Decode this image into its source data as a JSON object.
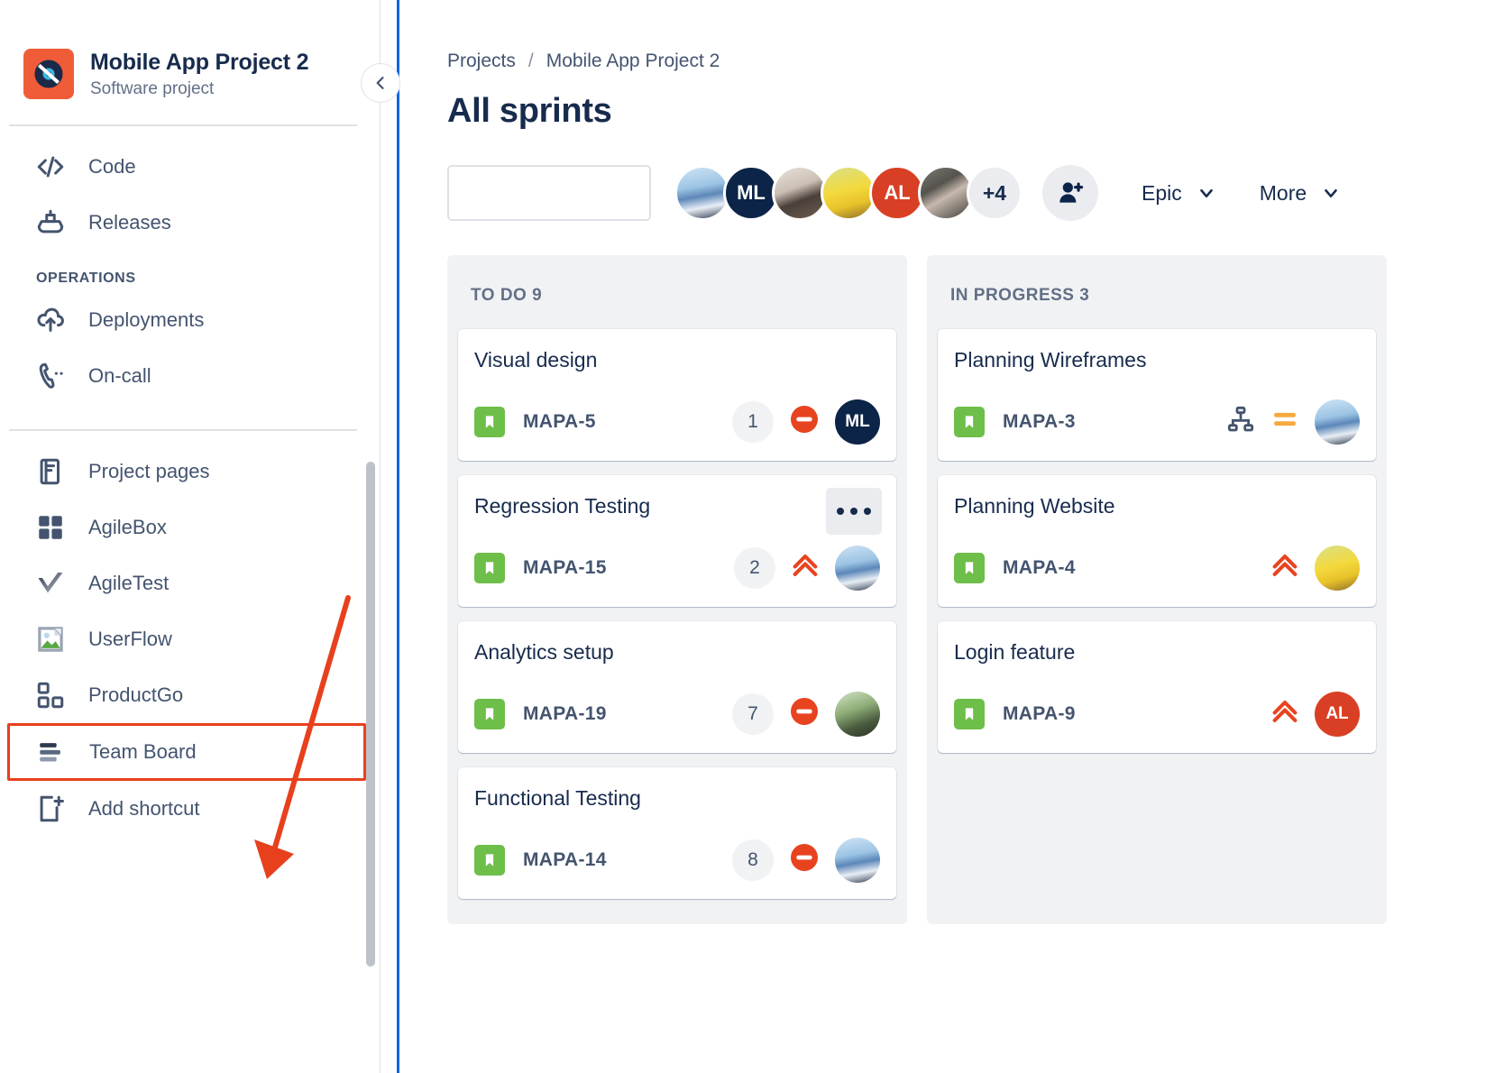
{
  "sidebar": {
    "project": {
      "name": "Mobile App Project 2",
      "type": "Software project",
      "avatar_icon": "vinyl-record-icon"
    },
    "items_top": [
      {
        "label": "Code",
        "icon": "code-icon"
      },
      {
        "label": "Releases",
        "icon": "ship-icon"
      }
    ],
    "section_operations": "OPERATIONS",
    "items_operations": [
      {
        "label": "Deployments",
        "icon": "cloud-upload-icon"
      },
      {
        "label": "On-call",
        "icon": "phone-icon"
      }
    ],
    "items_apps": [
      {
        "label": "Project pages",
        "icon": "page-icon"
      },
      {
        "label": "AgileBox",
        "icon": "grid-icon"
      },
      {
        "label": "AgileTest",
        "icon": "checkmark-icon"
      },
      {
        "label": "UserFlow",
        "icon": "image-icon"
      },
      {
        "label": "ProductGo",
        "icon": "squares-icon"
      },
      {
        "label": "Team Board",
        "icon": "bars-icon",
        "highlighted": true
      },
      {
        "label": "Add shortcut",
        "icon": "add-shortcut-icon"
      }
    ]
  },
  "header": {
    "breadcrumb": {
      "root": "Projects",
      "separator": "/",
      "current": "Mobile App Project 2"
    },
    "title": "All sprints"
  },
  "toolbar": {
    "search": {
      "value": "",
      "placeholder": ""
    },
    "avatars": [
      {
        "name": "member-1",
        "initials": "",
        "style": "ph-snow"
      },
      {
        "name": "member-2",
        "initials": "ML",
        "style": "ph-dark"
      },
      {
        "name": "member-3",
        "initials": "",
        "style": "ph-glass"
      },
      {
        "name": "member-4",
        "initials": "",
        "style": "ph-yellow"
      },
      {
        "name": "member-5",
        "initials": "AL",
        "style": "ph-red"
      },
      {
        "name": "member-6",
        "initials": "",
        "style": "ph-rock"
      }
    ],
    "overflow_label": "+4",
    "add_person_icon": "person-add-icon",
    "epic_filter": "Epic",
    "more_filter": "More",
    "chevron_icon": "chevron-down-icon"
  },
  "board": {
    "columns": [
      {
        "name": "todo",
        "header": "TO DO 9",
        "cards": [
          {
            "title": "Visual design",
            "key": "MAPA-5",
            "type_icon": "story-icon",
            "count": "1",
            "priority": "blocker",
            "avatar_style": "ph-dark",
            "avatar_initials": "ML",
            "has_menu": false,
            "has_link_icon": false
          },
          {
            "title": "Regression Testing",
            "key": "MAPA-15",
            "type_icon": "story-icon",
            "count": "2",
            "priority": "highest",
            "avatar_style": "ph-snow",
            "avatar_initials": "",
            "has_menu": true,
            "has_link_icon": false
          },
          {
            "title": "Analytics setup",
            "key": "MAPA-19",
            "type_icon": "story-icon",
            "count": "7",
            "priority": "blocker",
            "avatar_style": "ph-green",
            "avatar_initials": "",
            "has_menu": false,
            "has_link_icon": false
          },
          {
            "title": "Functional Testing",
            "key": "MAPA-14",
            "type_icon": "story-icon",
            "count": "8",
            "priority": "blocker",
            "avatar_style": "ph-snow",
            "avatar_initials": "",
            "has_menu": false,
            "has_link_icon": false
          }
        ]
      },
      {
        "name": "inprogress",
        "header": "IN PROGRESS 3",
        "cards": [
          {
            "title": "Planning Wireframes",
            "key": "MAPA-3",
            "type_icon": "story-icon",
            "count": "",
            "priority": "medium",
            "avatar_style": "ph-snow",
            "avatar_initials": "",
            "has_menu": false,
            "has_link_icon": true
          },
          {
            "title": "Planning Website",
            "key": "MAPA-4",
            "type_icon": "story-icon",
            "count": "",
            "priority": "highest",
            "avatar_style": "ph-yellow",
            "avatar_initials": "",
            "has_menu": false,
            "has_link_icon": false
          },
          {
            "title": "Login feature",
            "key": "MAPA-9",
            "type_icon": "story-icon",
            "count": "",
            "priority": "highest",
            "avatar_style": "ph-red",
            "avatar_initials": "AL",
            "has_menu": false,
            "has_link_icon": false
          }
        ]
      }
    ]
  },
  "colors": {
    "accent_blue": "#0c66e4",
    "annotation_red": "#e8401d",
    "story_green": "#6ebe4a",
    "priority_orange": "#e8431f",
    "priority_medium": "#f5a93f",
    "text_dark": "#172b4d",
    "text_muted": "#626f86"
  }
}
